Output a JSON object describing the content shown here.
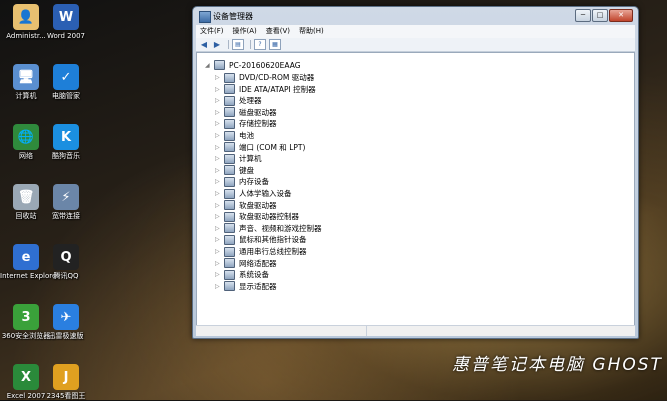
{
  "desktop": {
    "icons": [
      {
        "label": "Administr...",
        "glyph": "👤",
        "color": "#e8c070"
      },
      {
        "label": "Word 2007",
        "glyph": "W",
        "color": "#2b5fb3"
      },
      {
        "label": "计算机",
        "glyph": "🖥",
        "color": "#5a8fd0"
      },
      {
        "label": "电脑管家",
        "glyph": "✓",
        "color": "#1e7fd8"
      },
      {
        "label": "网络",
        "glyph": "🌐",
        "color": "#2f8a3c"
      },
      {
        "label": "酷狗音乐",
        "glyph": "K",
        "color": "#1b8fe0"
      },
      {
        "label": "回收站",
        "glyph": "🗑",
        "color": "#9aa8b5"
      },
      {
        "label": "宽带连接",
        "glyph": "⚡",
        "color": "#6b86a8"
      },
      {
        "label": "Internet Explorer",
        "glyph": "e",
        "color": "#2f6fd1"
      },
      {
        "label": "腾讯QQ",
        "glyph": "Q",
        "color": "#222"
      },
      {
        "label": "360安全浏览器",
        "glyph": "3",
        "color": "#3aa13a"
      },
      {
        "label": "迅雷极速版",
        "glyph": "✈",
        "color": "#2a7fe0"
      },
      {
        "label": "Excel 2007",
        "glyph": "X",
        "color": "#2a8a3a"
      },
      {
        "label": "2345看图王",
        "glyph": "J",
        "color": "#e0a020"
      }
    ],
    "brand": "惠普笔记本电脑 GHOST WI"
  },
  "window": {
    "title": "设备管理器",
    "controls": {
      "minimize": "─",
      "maximize": "□",
      "close": "✕"
    },
    "menu": [
      "文件(F)",
      "操作(A)",
      "查看(V)",
      "帮助(H)"
    ],
    "toolbar_icons": [
      "back-arrow-icon",
      "forward-arrow-icon",
      "properties-icon",
      "help-icon",
      "grid-icon"
    ],
    "tree": {
      "root": "PC-20160620EAAG",
      "items": [
        "DVD/CD-ROM 驱动器",
        "IDE ATA/ATAPI 控制器",
        "处理器",
        "磁盘驱动器",
        "存储控制器",
        "电池",
        "端口 (COM 和 LPT)",
        "计算机",
        "键盘",
        "内存设备",
        "人体学输入设备",
        "软盘驱动器",
        "软盘驱动器控制器",
        "声音、视频和游戏控制器",
        "鼠标和其他指针设备",
        "通用串行总线控制器",
        "网络适配器",
        "系统设备",
        "显示适配器"
      ]
    }
  }
}
